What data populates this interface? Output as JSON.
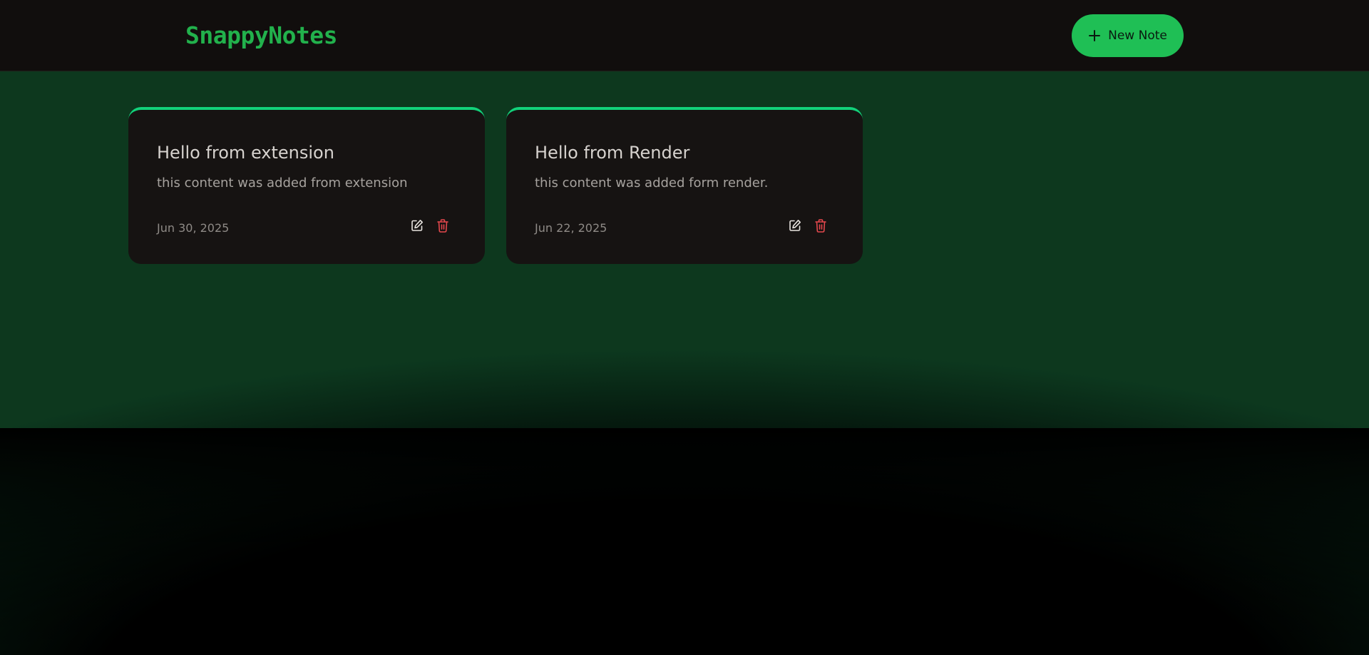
{
  "app": {
    "logo": "SnappyNotes",
    "new_note_label": "New Note",
    "accent": "#1fbf55"
  },
  "notes": [
    {
      "title": "Hello from extension",
      "content": "this content was added from extension",
      "date": "Jun 30, 2025"
    },
    {
      "title": "Hello from Render",
      "content": "this content was added form render.",
      "date": "Jun 22, 2025"
    }
  ],
  "icons": {
    "new_note": "plus-icon",
    "edit": "edit-icon",
    "delete": "trash-icon"
  },
  "colors": {
    "card_top_border": "#12d17a",
    "delete_icon": "#e5484d",
    "edit_icon": "#e8e4e0"
  }
}
